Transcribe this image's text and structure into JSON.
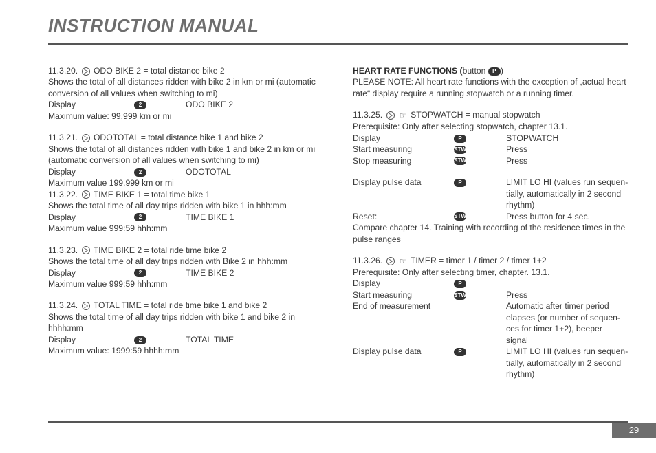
{
  "header": {
    "title": "INSTRUCTION MANUAL"
  },
  "s20": {
    "heading": "11.3.20.",
    "title": "ODO BIKE 2 = total distance bike 2",
    "desc": "Shows the total of all distances ridden with bike 2 in km or mi (automatic conversion of all values when switching to mi)",
    "displayLabel": "Display",
    "displayValue": "ODO BIKE 2",
    "max": "Maximum value: 99,999 km or mi"
  },
  "s21": {
    "heading": "11.3.21.",
    "title": "ODOTOTAL = total distance bike 1 and bike 2",
    "desc": "Shows the total of all distances ridden with bike 1 and bike 2 in km or mi (automatic conversion of all values when switching to mi)",
    "displayLabel": "Display",
    "displayValue": "ODOTOTAL",
    "max": "Maximum value 199,999 km or mi"
  },
  "s22": {
    "heading": "11.3.22.",
    "title": "TIME BIKE 1 = total time bike 1",
    "desc": "Shows the total time of all day trips ridden with bike 1 in hhh:mm",
    "displayLabel": "Display",
    "displayValue": "TIME BIKE 1",
    "max": "Maximum value 999:59 hhh:mm"
  },
  "s23": {
    "heading": "11.3.23.",
    "title": "TIME BIKE 2 = total ride time bike 2",
    "desc": "Shows the total time of all day trips ridden with Bike 2 in hhh:mm",
    "displayLabel": "Display",
    "displayValue": "TIME BIKE 2",
    "max": "Maximum value 999:59 hhh:mm"
  },
  "s24": {
    "heading": "11.3.24.",
    "title": "TOTAL TIME = total ride time bike 1 and bike 2",
    "desc": "Shows the total time of all day trips ridden with bike 1 and bike 2 in hhhh:mm",
    "displayLabel": "Display",
    "displayValue": "TOTAL TIME",
    "max": "Maximum value: 1999:59 hhhh:mm"
  },
  "hr": {
    "headingBold": "HEART RATE FUNCTIONS (",
    "headingRest": "button",
    "headingEnd": ")",
    "note": "PLEASE NOTE: All heart rate functions with the exception of „actual heart rate“ display require a running stopwatch or a running timer."
  },
  "s25": {
    "heading": "11.3.25.",
    "title": "STOPWATCH = manual stopwatch",
    "prereq": "Prerequisite: Only after selecting stopwatch, chapter 13.1.",
    "rows": {
      "displayL": "Display",
      "displayV": "STOPWATCH",
      "startL": "Start measuring",
      "startV": "Press",
      "stopL": "Stop measuring",
      "stopV": "Press",
      "pulseL": "Display pulse data",
      "pulseV1": "LIMIT LO HI (values run sequen-",
      "pulseV2": "tially, automatically in 2 second",
      "pulseV3": "rhythm)",
      "resetL": "Reset:",
      "resetV": "Press button for 4 sec."
    },
    "compare": "Compare chapter 14. Training with recording of the residence times in the pulse ranges"
  },
  "s26": {
    "heading": "11.3.26.",
    "title": "TIMER = timer 1 / timer 2 / timer 1+2",
    "prereq": "Prerequisite: Only after selecting timer, chapter. 13.1.",
    "rows": {
      "displayL": "Display",
      "startL": "Start measuring",
      "startV": "Press",
      "endL": "End of measurement",
      "endV1": "Automatic after timer period",
      "endV2": "elapses (or number of sequen-",
      "endV3": "ces for timer 1+2), beeper",
      "endV4": "signal",
      "pulseL": "Display pulse data",
      "pulseV1": "LIMIT LO HI (values run sequen-",
      "pulseV2": "tially, automatically in 2 second",
      "pulseV3": "rhythm)"
    }
  },
  "icons": {
    "two": "2",
    "p": "P",
    "stw": "STW"
  },
  "page": "29"
}
